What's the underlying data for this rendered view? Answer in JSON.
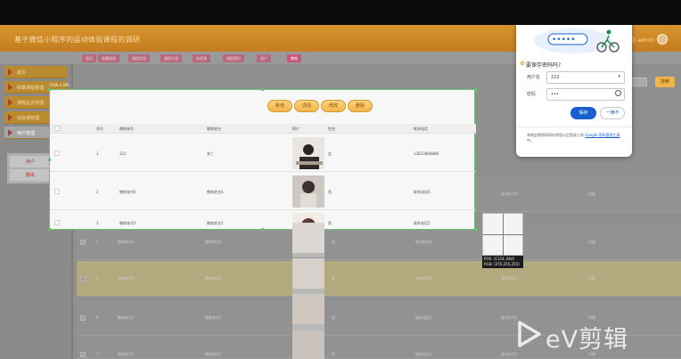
{
  "app": {
    "title": "基于微信小程序的运动体验课程的调研",
    "user": "欢迎 admin"
  },
  "tabs": [
    "首页",
    "收藏课程",
    "课程信息",
    "课程分类",
    "体验课",
    "课程预约",
    "用户",
    "教练"
  ],
  "sidebar": {
    "items": [
      "首页",
      "收藏课程管理",
      "课程信息管理",
      "体验课管理",
      "用户管理"
    ],
    "sub_items": [
      "用户",
      "教练"
    ]
  },
  "toolbar": {
    "add_label": "新增",
    "detail_label": "详情",
    "edit_label": "修改",
    "delete_label": "删除",
    "search_label": "搜索"
  },
  "table": {
    "headers": [
      "序号",
      "教练账号",
      "教练姓名",
      "照片",
      "性别",
      "联系电话",
      "身份证号"
    ],
    "rows": [
      {
        "index": "1",
        "account": "222",
        "name": "張三",
        "gender": "女",
        "phone": "13823888888",
        "idcard": ""
      },
      {
        "index": "2",
        "account": "教练账号6",
        "name": "教练姓名6",
        "gender": "男",
        "phone": "联系电话6",
        "idcard": "身份证号6"
      },
      {
        "index": "3",
        "account": "教练账号5",
        "name": "教练姓名5",
        "gender": "男",
        "phone": "联系电话5",
        "idcard": "身份证号5"
      },
      {
        "index": "4",
        "account": "教练账号4",
        "name": "教练姓名4",
        "gender": "男",
        "phone": "联系电话4",
        "idcard": "身份证号4"
      },
      {
        "index": "5",
        "account": "教练账号3",
        "name": "教练姓名3",
        "gender": "男",
        "phone": "联系电话3",
        "idcard": "身份证号3"
      },
      {
        "index": "6",
        "account": "教练账号2",
        "name": "教练姓名2",
        "gender": "男",
        "phone": "联系电话2",
        "idcard": "身份证号2"
      },
      {
        "index": "7",
        "account": "教练账号1",
        "name": "教练姓名1",
        "gender": "男",
        "phone": "联系电话1",
        "idcard": "身份证号1"
      }
    ],
    "action_label": "详情"
  },
  "capture": {
    "size_label": "1166 x 395",
    "pos_label": "POS: (1124, 664)",
    "rgb_label": "RGB: (255,255,255)"
  },
  "password_popup": {
    "question": "要保存密码吗?",
    "username_label": "用户名",
    "username_value": "222",
    "password_label": "密码",
    "password_value": "•••",
    "save_label": "保存",
    "cancel_label": "一律不",
    "note_prefix": "系统会将密码保存到您以后登录上的",
    "note_link": "Google 密码管理工具",
    "note_suffix": "中。",
    "dots": "•••••"
  },
  "watermark": {
    "text": "eV剪辑"
  },
  "colors": {
    "accent_orange": "#f0b54a",
    "primary_blue": "#1a5fd0",
    "selection_green": "#6fbf73"
  }
}
